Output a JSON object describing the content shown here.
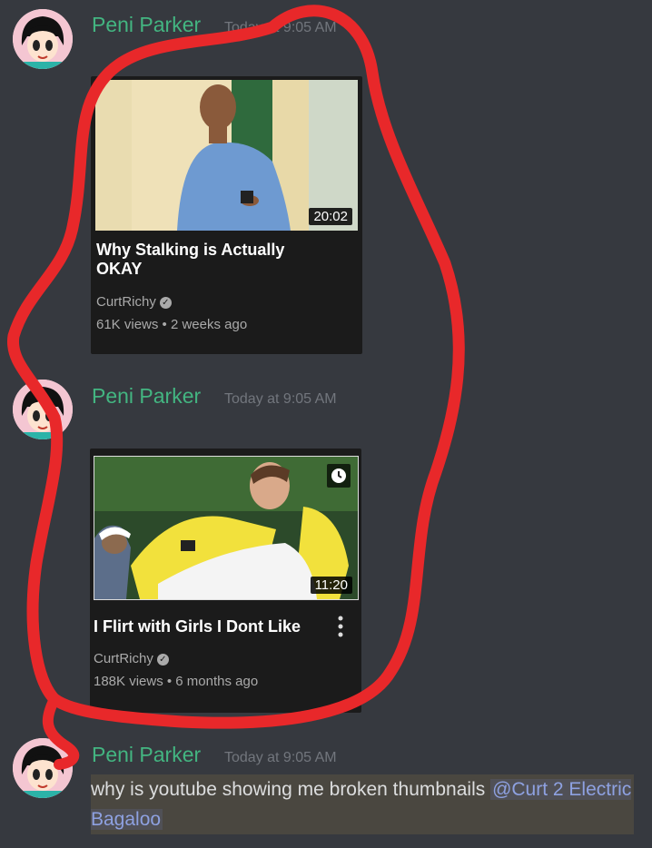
{
  "messages": [
    {
      "username": "Peni Parker",
      "timestamp": "Today at 9:05 AM",
      "video": {
        "title": "Why Stalking is Actually OKAY",
        "channel": "CurtRichy",
        "meta": "61K views • 2 weeks ago",
        "duration": "20:02"
      }
    },
    {
      "username": "Peni Parker",
      "timestamp": "Today at 9:05 AM",
      "video": {
        "title": "I Flirt with Girls I Dont Like",
        "channel": "CurtRichy",
        "meta": "188K views • 6 months ago",
        "duration": "11:20"
      }
    },
    {
      "username": "Peni Parker",
      "timestamp": "Today at 9:05 AM",
      "text": "why is youtube showing me broken thumbnails ",
      "mention": "@Curt 2 Electric Bagaloo"
    }
  ],
  "icons": {
    "verified": "check-circle-icon",
    "watch_later": "clock-icon",
    "more": "more-vertical-icon"
  },
  "colors": {
    "background": "#36393f",
    "username": "#43b581",
    "timestamp": "#72767d",
    "mention": "#8ea1e1",
    "annotation": "#e8282a"
  }
}
